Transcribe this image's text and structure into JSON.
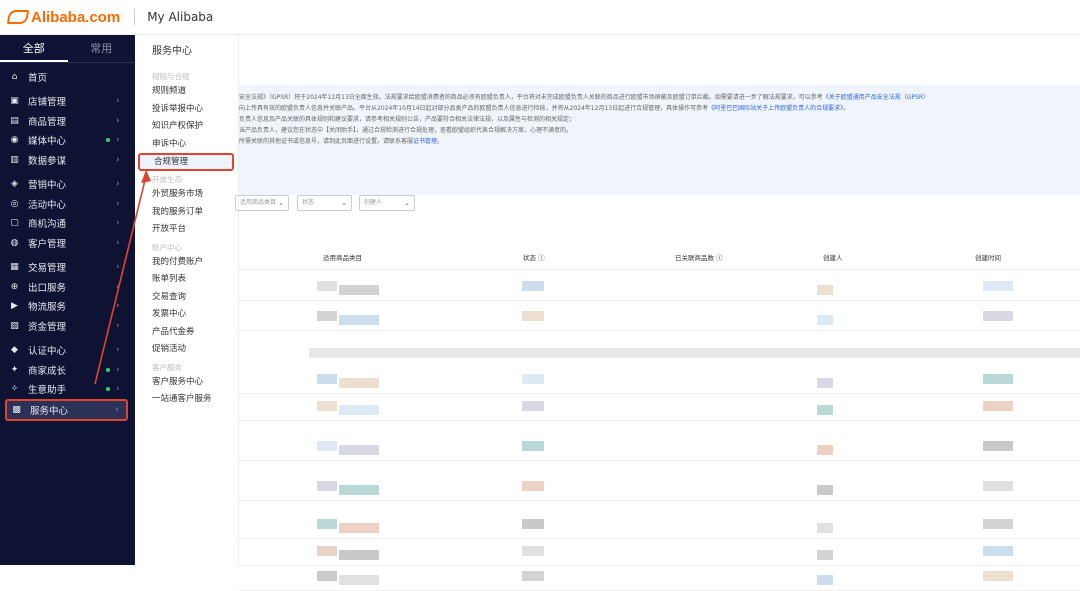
{
  "header": {
    "logo_text": "Alibaba.com",
    "app_title": "My Alibaba"
  },
  "sidebar": {
    "tabs": [
      {
        "label": "全部",
        "active": true
      },
      {
        "label": "常用",
        "active": false
      }
    ],
    "items": [
      {
        "label": "首页",
        "icon": "home-icon",
        "glyph": "⌂",
        "dot": false,
        "chevron": false,
        "group_break": false
      },
      {
        "label": "店铺管理",
        "icon": "store-icon",
        "glyph": "▣",
        "dot": false,
        "chevron": true,
        "group_break": true
      },
      {
        "label": "商品管理",
        "icon": "product-icon",
        "glyph": "▤",
        "dot": false,
        "chevron": true,
        "group_break": false
      },
      {
        "label": "媒体中心",
        "icon": "media-icon",
        "glyph": "◉",
        "dot": true,
        "chevron": true,
        "group_break": false
      },
      {
        "label": "数据参谋",
        "icon": "data-chart-icon",
        "glyph": "▥",
        "dot": false,
        "chevron": true,
        "group_break": false
      },
      {
        "label": "营销中心",
        "icon": "marketing-icon",
        "glyph": "◈",
        "dot": false,
        "chevron": true,
        "group_break": true
      },
      {
        "label": "活动中心",
        "icon": "activity-icon",
        "glyph": "◎",
        "dot": false,
        "chevron": true,
        "group_break": false
      },
      {
        "label": "商机沟通",
        "icon": "message-icon",
        "glyph": "▢",
        "dot": false,
        "chevron": true,
        "group_break": false
      },
      {
        "label": "客户管理",
        "icon": "customer-icon",
        "glyph": "◍",
        "dot": false,
        "chevron": true,
        "group_break": false
      },
      {
        "label": "交易管理",
        "icon": "trade-icon",
        "glyph": "▦",
        "dot": false,
        "chevron": true,
        "group_break": true
      },
      {
        "label": "出口服务",
        "icon": "export-icon",
        "glyph": "⊕",
        "dot": false,
        "chevron": true,
        "group_break": false
      },
      {
        "label": "物流服务",
        "icon": "logistics-icon",
        "glyph": "▶",
        "dot": false,
        "chevron": true,
        "group_break": false
      },
      {
        "label": "资金管理",
        "icon": "finance-icon",
        "glyph": "▧",
        "dot": false,
        "chevron": true,
        "group_break": false
      },
      {
        "label": "认证中心",
        "icon": "certification-icon",
        "glyph": "◆",
        "dot": false,
        "chevron": true,
        "group_break": true
      },
      {
        "label": "商家成长",
        "icon": "growth-icon",
        "glyph": "✦",
        "dot": true,
        "chevron": true,
        "group_break": false
      },
      {
        "label": "生意助手",
        "icon": "assistant-icon",
        "glyph": "✧",
        "dot": true,
        "chevron": true,
        "group_break": false
      },
      {
        "label": "服务中心",
        "icon": "service-icon",
        "glyph": "▩",
        "dot": false,
        "chevron": true,
        "group_break": false,
        "active": true
      }
    ]
  },
  "submenu": {
    "title": "服务中心",
    "groups": [
      {
        "label": "规则与合规",
        "items": [
          "规则频道",
          "投诉举报中心",
          "知识产权保护",
          "申诉中心",
          "合规管理"
        ]
      },
      {
        "label": "开放生态",
        "items": [
          "外贸服务市场",
          "我的服务订单",
          "开放平台"
        ]
      },
      {
        "label": "账户中心",
        "items": [
          "我的付费账户",
          "账单列表",
          "交易查询",
          "发票中心",
          "产品代金券",
          "促销活动"
        ]
      },
      {
        "label": "客户服务",
        "items": [
          "客户服务中心",
          "一站通客户服务"
        ]
      }
    ],
    "active_item": "合规管理"
  },
  "notice": {
    "lines": [
      {
        "text": "安全法规》（GPSR）将于2024年12月13日全面生效。法规要求给欧盟消费者的商品必须有欧盟负责人，平台将对未完成欧盟负责人关联的商品进行欧盟市场屏蔽及欧盟订单拦截。如需要请进一步了解法规要求，可以参考",
        "link": "《关于欧盟通用产品安全法规（GPSR）",
        "tail": ""
      },
      {
        "text": "向上传具有效的欧盟负责人信息并关联产品。平台从2024年10月14日起对部分品类产品的欧盟负责人信息进行检核，并将从2024年12月13日起进行合规管理，具体操作可参考",
        "link": "《阿里巴巴国际站关于上传欧盟负责人的合规要求》",
        "tail": "。"
      },
      {
        "text": "负责人信息及产品关联的具体规则和建议要求，请参考相关规则公告，产品要符合相关法律法规，以及属性与检测的相关规定；",
        "link": "",
        "tail": ""
      },
      {
        "text": "当产品负责人，建议您在状态中【关闭助手】，通过合规检测进行合规处理，查看欧盟组织代表合规解决方案，心理不满意的。",
        "link": "",
        "tail": ""
      },
      {
        "text": "所需关联的其他证书或信息号，请到此页面进行设置。请联系客服",
        "link": "证书管理",
        "tail": "。"
      }
    ]
  },
  "filters": [
    {
      "placeholder": "适用商品类目"
    },
    {
      "placeholder": "状态"
    },
    {
      "placeholder": "创建人"
    }
  ],
  "table": {
    "columns": [
      {
        "label": "适用商品类目",
        "help": false
      },
      {
        "label": "状态",
        "help": true
      },
      {
        "label": "已关联商品数",
        "help": true
      },
      {
        "label": "创建人",
        "help": false
      },
      {
        "label": "创建时间",
        "help": false
      }
    ]
  }
}
